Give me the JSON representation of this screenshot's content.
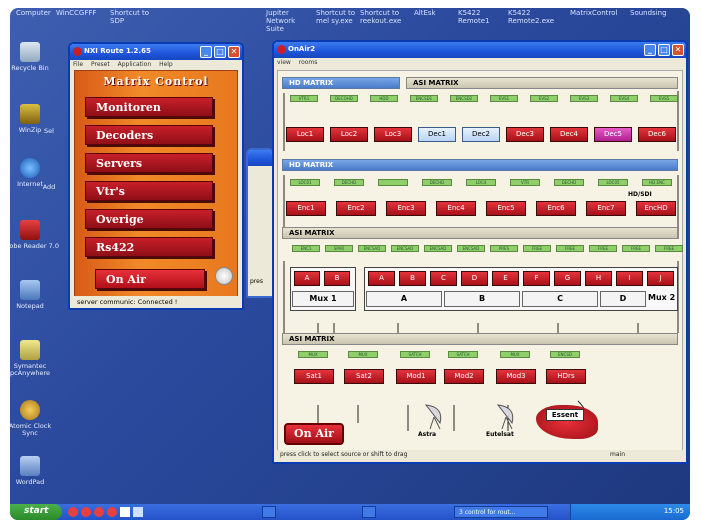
{
  "desktop": {
    "top_labels": [
      "Computer",
      "WinCCGFFF",
      "Shortcut to SDP",
      "Jupiter Network Suite",
      "Shortcut to mel sy.exe",
      "Shortcut to reekout.exe",
      "AltEsk",
      "K5422 Remote1",
      "K5422 Remote2.exe",
      "MatrixControl",
      "Soundsing"
    ],
    "icons": [
      {
        "label": "Recycle Bin"
      },
      {
        "label": "WinZip"
      },
      {
        "label": "Internet"
      },
      {
        "label": "Adobe Reader 7.0"
      },
      {
        "label": "Notepad"
      },
      {
        "label": "Symantec pcAnywhere"
      },
      {
        "label": "Atomic Clock Sync"
      },
      {
        "label": "WordPad"
      }
    ],
    "icon_partial": [
      "Sel",
      "Add"
    ]
  },
  "matrix_window": {
    "title": "NXI Route 1.2.65",
    "menu": [
      "File",
      "Preset",
      "Application",
      "Help"
    ],
    "heading": "Matrix Control",
    "buttons": [
      "Monitoren",
      "Decoders",
      "Servers",
      "Vtr's",
      "Overige",
      "Rs422",
      "On Air"
    ],
    "status": "server communic: Connected !"
  },
  "onair_window": {
    "title": "OnAir2",
    "menu": [
      "view",
      "rooms"
    ],
    "bars": {
      "hd1": "HD MATRIX",
      "asi1": "ASI MATRIX",
      "hd2": "HD MATRIX",
      "asi2": "ASI MATRIX",
      "asi3": "ASI MATRIX"
    },
    "row1": {
      "tags": [
        "VTR1",
        "DECOHD",
        "HDD",
        "ENCSD1",
        "ENCSD2",
        "EVS1",
        "EVS2",
        "EVS3",
        "EVS4",
        "EVS5"
      ],
      "nodes": [
        "Loc1",
        "Loc2",
        "Loc3",
        "Dec1",
        "Dec2",
        "Dec3",
        "Dec4",
        "Dec5",
        "Dec6"
      ]
    },
    "row2": {
      "tags": [
        "LOC01",
        "DECHD",
        "",
        "DECHD",
        "LOC4",
        "VTR",
        "DECHD",
        "LOC05",
        "HD ENC"
      ],
      "nodes": [
        "Enc1",
        "Enc2",
        "Enc3",
        "Enc4",
        "Enc5",
        "Enc6",
        "Enc7",
        "EncHD"
      ],
      "hdsdi": "HD/SDI"
    },
    "row3": {
      "tags": [
        "ENC1",
        "SPAR",
        "ENCSAD",
        "ENCSAD",
        "ENCSAD",
        "ENCSAD",
        "PRES",
        "FREE",
        "FREE",
        "FREE",
        "FREE",
        "FREE"
      ],
      "mux1_inputs": [
        "A",
        "B"
      ],
      "mux2_inputs": [
        "A",
        "B",
        "C",
        "D",
        "E",
        "F",
        "G",
        "H",
        "I",
        "J"
      ],
      "mux1_label": "Mux 1",
      "mux2_labels": [
        "A",
        "B",
        "C",
        "D"
      ],
      "mux2_label": "Mux 2"
    },
    "row4": {
      "tags": [
        "MUX",
        "MUX",
        "SATCH",
        "SATCH",
        "MUX",
        "ENCSD"
      ],
      "nodes": [
        "Sat1",
        "Sat2",
        "Mod1",
        "Mod2",
        "Mod3",
        "HDrs"
      ]
    },
    "satellites": [
      "Astra",
      "Eutelsat"
    ],
    "essent": "Essent",
    "onair_button": "On Air",
    "status_left": "press click to select source or shift to drag",
    "status_right": "main"
  },
  "partial_window": {
    "label": "pres"
  },
  "taskbar": {
    "start": "start",
    "items": [
      "3 control for rout..."
    ],
    "clock": "15:05"
  }
}
